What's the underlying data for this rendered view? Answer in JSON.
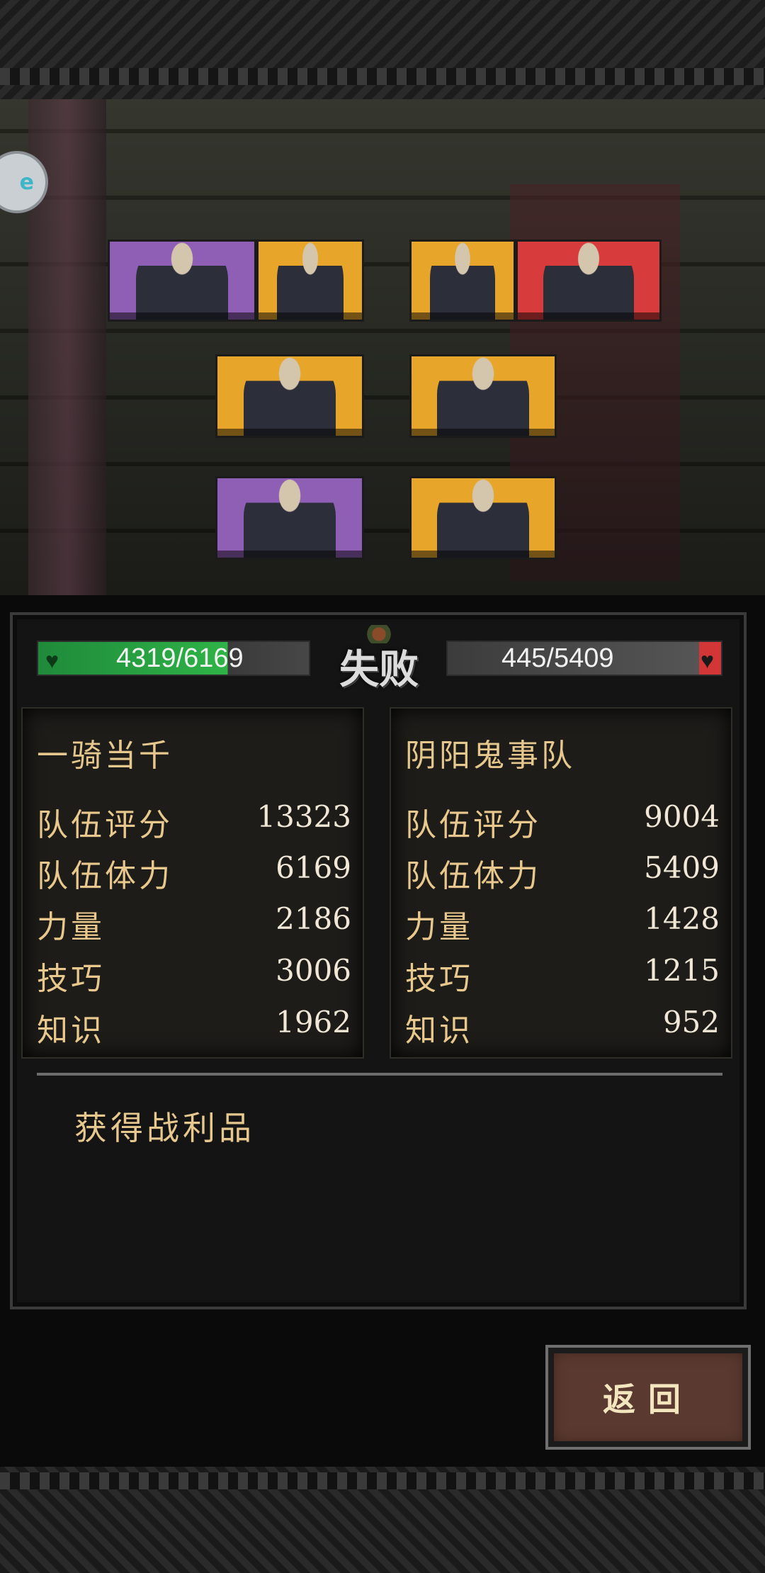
{
  "side_badge": {
    "text": "e"
  },
  "battle": {
    "result": "失败",
    "left_hp": "4319/6169",
    "right_hp": "445/5409",
    "left_hp_fraction": 0.7,
    "right_hp_fraction": 0.08
  },
  "left_team": {
    "name": "一骑当千",
    "stats": [
      {
        "label": "队伍评分",
        "value": "13323"
      },
      {
        "label": "队伍体力",
        "value": "6169"
      },
      {
        "label": "力量",
        "value": "2186"
      },
      {
        "label": "技巧",
        "value": "3006"
      },
      {
        "label": "知识",
        "value": "1962"
      }
    ]
  },
  "right_team": {
    "name": "阴阳鬼事队",
    "stats": [
      {
        "label": "队伍评分",
        "value": "9004"
      },
      {
        "label": "队伍体力",
        "value": "5409"
      },
      {
        "label": "力量",
        "value": "1428"
      },
      {
        "label": "技巧",
        "value": "1215"
      },
      {
        "label": "知识",
        "value": "952"
      }
    ]
  },
  "loot": {
    "label": "获得战利品"
  },
  "buttons": {
    "return_label": "返回"
  },
  "colors": {
    "purple": "#8e5fb5",
    "gold": "#e7a62a",
    "red": "#d83b3b",
    "hp_green": "#2fb347",
    "hp_red": "#d23636"
  }
}
